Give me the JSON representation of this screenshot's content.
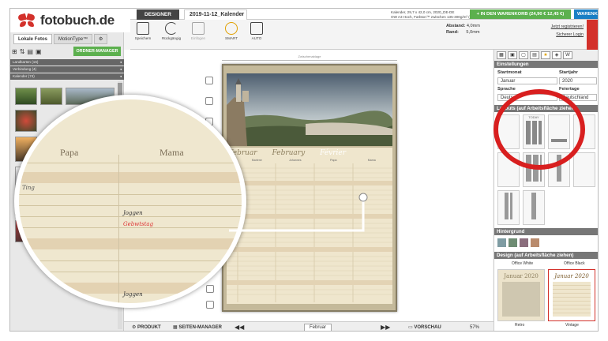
{
  "app": {
    "logo": "fotobuch.de"
  },
  "topbar": {
    "designer_tab": "DESIGNER",
    "file_tab": "2019-11-12_Kalender",
    "close_symbol": "×",
    "product_info_line1": "Kalender, 29,7 x 42,0 cm, 2020_DE-DE",
    "product_info_line2": "OW A3 Hoch, Farbton™ zwischen 135-300g/m² (hochglanz)",
    "cart_button": "+ IN DEN WARENKORB (24,90 € 12,45 €)",
    "cart_button_short": "WARENKORB"
  },
  "left_panel": {
    "tabs": [
      "Lokale Fotos",
      "MotionType™",
      "⚙"
    ],
    "tools": [
      "⊞",
      "⇅",
      "▤",
      "▣"
    ],
    "ordner_button": "ORDNER-MANAGER",
    "folders": [
      "Landkarten (16)",
      "Verbindung (4)",
      "Kalender (74)"
    ]
  },
  "toolbar": {
    "tools": [
      {
        "label": "Speichern",
        "icon": "save-icon"
      },
      {
        "label": "Rückgängig",
        "icon": "undo-icon"
      },
      {
        "label": "Einfügen",
        "icon": "paste-icon"
      },
      {
        "label": "SMART",
        "icon": "bulb-icon"
      },
      {
        "label": "AUTO",
        "icon": "auto-icon"
      }
    ],
    "abstand_label": "Abstand:",
    "abstand_value": "4,0mm",
    "rand_label": "Rand:",
    "rand_value": "5,0mm",
    "register_link": "Jetzt registrieren!",
    "login_link": "Sicherer Login"
  },
  "canvas": {
    "ruler_label": "Zwischenablage",
    "month_names": [
      "Februar",
      "February",
      "Février"
    ],
    "column_headers": [
      "Marlene",
      "Johannes",
      "Papa",
      "Mama"
    ]
  },
  "bottombar": {
    "produkt": "PRODUKT",
    "seiten_manager": "SEITEN-MANAGER",
    "page_name": "Februar",
    "vorschau": "VORSCHAU",
    "zoom": "57%"
  },
  "right_panel": {
    "einstellungen": "Einstellungen",
    "startmonat_label": "Startmonat",
    "startjahr_label": "Startjahr",
    "startmonat_value": "Januar",
    "startjahr_value": "2020",
    "sprache_label": "Sprache",
    "feiertage_label": "Feiertage",
    "sprache_value": "Deutsch",
    "feiertage_value": "Deutschland",
    "layouts_header": "Layouts (auf Arbeitsfläche ziehen)",
    "layout_sample_label": "TODAY",
    "hintergrund_header": "Hintergrund",
    "hintergrund_colors": [
      "#7f9ca3",
      "#6e8c73",
      "#8b6e7d",
      "#b98b6d"
    ],
    "design_header": "Design (auf Arbeitsfläche ziehen)",
    "design_names": [
      "Office White",
      "Office Black"
    ],
    "design_titles": [
      "Januar 2020",
      "Januar 2020"
    ],
    "design_footers": [
      "Retro",
      "Vintage"
    ]
  },
  "magnifier": {
    "col1": "Papa",
    "col2": "Mama",
    "entries": [
      "Joggen",
      "Gebwtstag",
      "Joggen",
      "Ting"
    ]
  }
}
